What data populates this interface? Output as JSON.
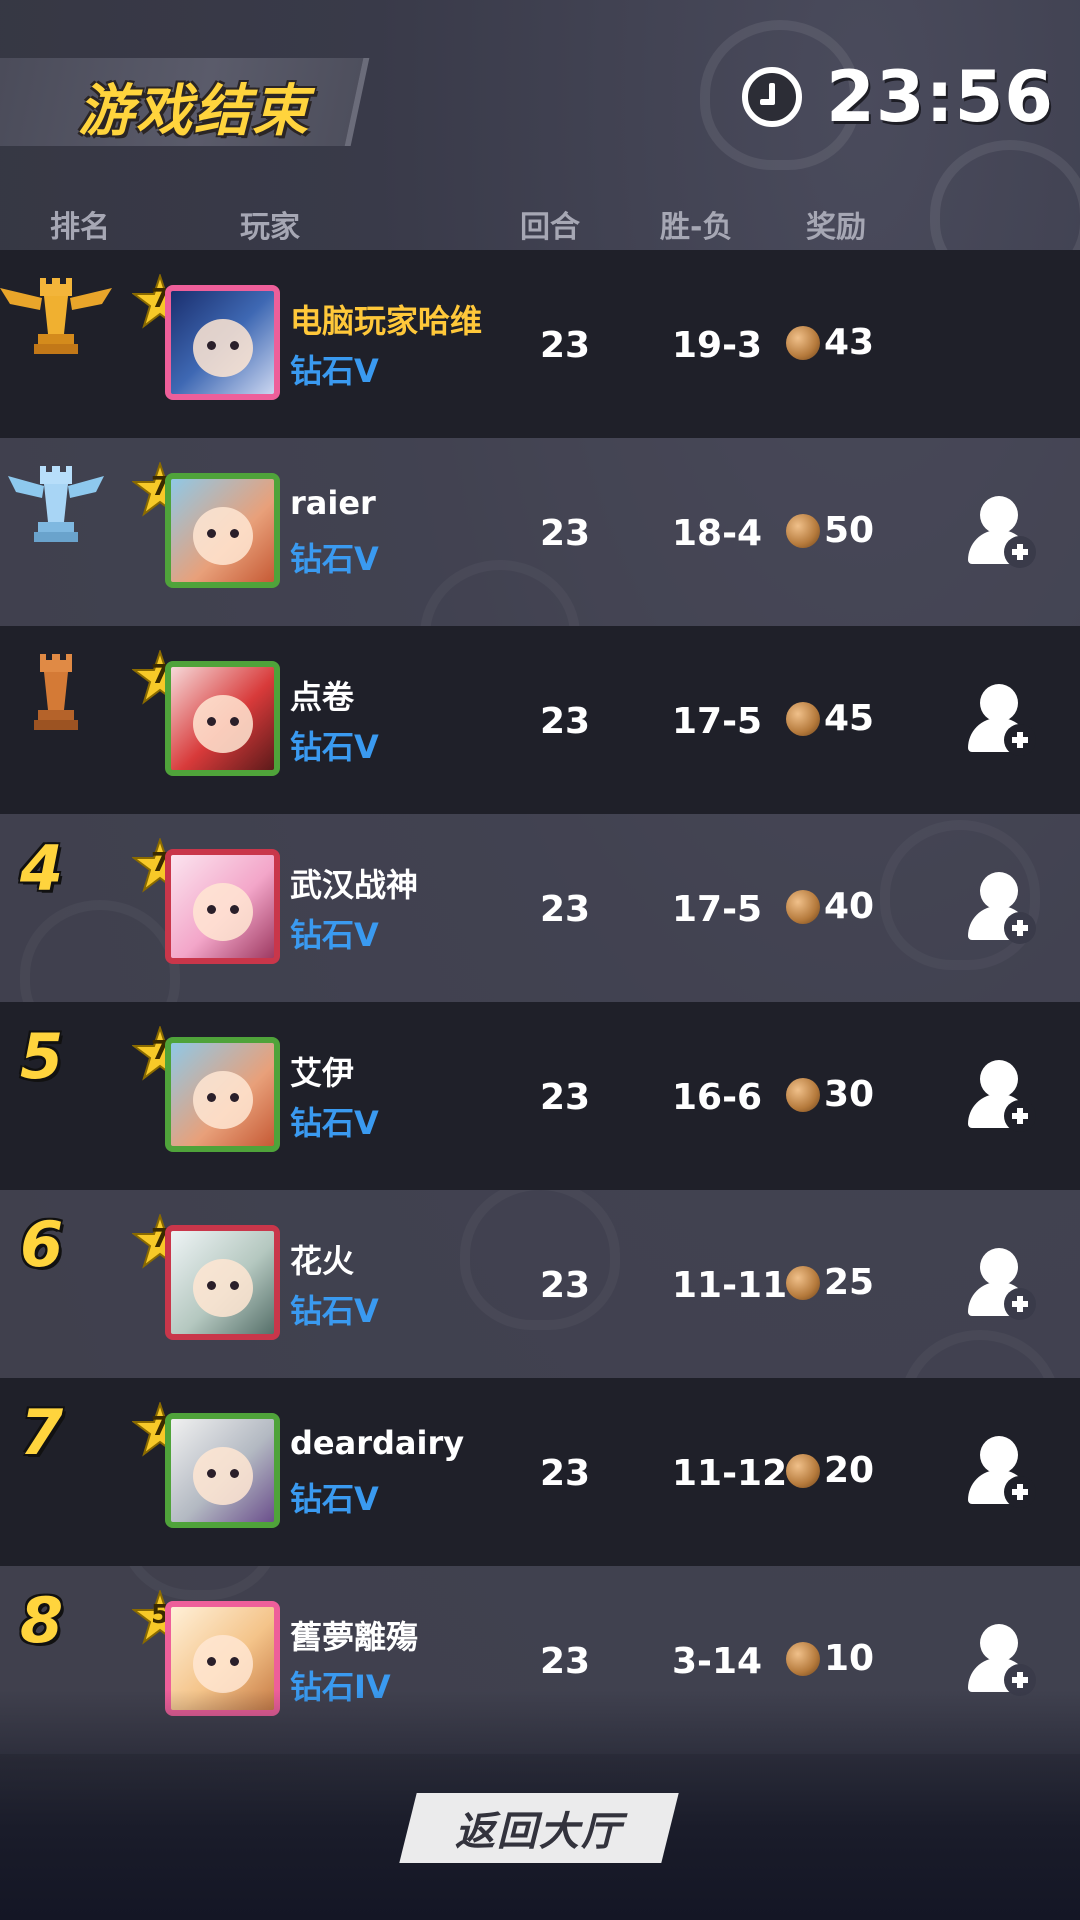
{
  "header": {
    "title": "游戏结束",
    "timer": "23:56"
  },
  "columns": {
    "rank": "排名",
    "player": "玩家",
    "rounds": "回合",
    "win_loss": "胜-负",
    "reward": "奖励"
  },
  "players": [
    {
      "rank": "1",
      "rank_icon": "gold-rook-trophy-icon",
      "level": "7",
      "name": "电脑玩家哈维",
      "tier": "钻石V",
      "rounds": "23",
      "win_loss": "19-3",
      "reward": "43",
      "can_add_friend": false
    },
    {
      "rank": "2",
      "rank_icon": "silver-rook-trophy-icon",
      "level": "7",
      "name": "raier",
      "tier": "钻石V",
      "rounds": "23",
      "win_loss": "18-4",
      "reward": "50",
      "can_add_friend": true
    },
    {
      "rank": "3",
      "rank_icon": "bronze-rook-trophy-icon",
      "level": "7",
      "name": "点卷",
      "tier": "钻石V",
      "rounds": "23",
      "win_loss": "17-5",
      "reward": "45",
      "can_add_friend": true
    },
    {
      "rank": "4",
      "level": "7",
      "name": "武汉战神",
      "tier": "钻石V",
      "rounds": "23",
      "win_loss": "17-5",
      "reward": "40",
      "can_add_friend": true
    },
    {
      "rank": "5",
      "level": "7",
      "name": "艾伊",
      "tier": "钻石V",
      "rounds": "23",
      "win_loss": "16-6",
      "reward": "30",
      "can_add_friend": true
    },
    {
      "rank": "6",
      "level": "7",
      "name": "花火",
      "tier": "钻石V",
      "rounds": "23",
      "win_loss": "11-11",
      "reward": "25",
      "can_add_friend": true
    },
    {
      "rank": "7",
      "level": "7",
      "name": "deardairy",
      "tier": "钻石V",
      "rounds": "23",
      "win_loss": "11-12",
      "reward": "20",
      "can_add_friend": true
    },
    {
      "rank": "8",
      "level": "5",
      "name": "舊夢離殤",
      "tier": "钻石IV",
      "rounds": "23",
      "win_loss": "3-14",
      "reward": "10",
      "can_add_friend": true
    }
  ],
  "footer": {
    "back_label": "返回大厅"
  },
  "colors": {
    "accent_gold": "#ffd43d",
    "tier_blue": "#3a9af0",
    "row_dark": "#1f2029",
    "background": "#393a49"
  }
}
